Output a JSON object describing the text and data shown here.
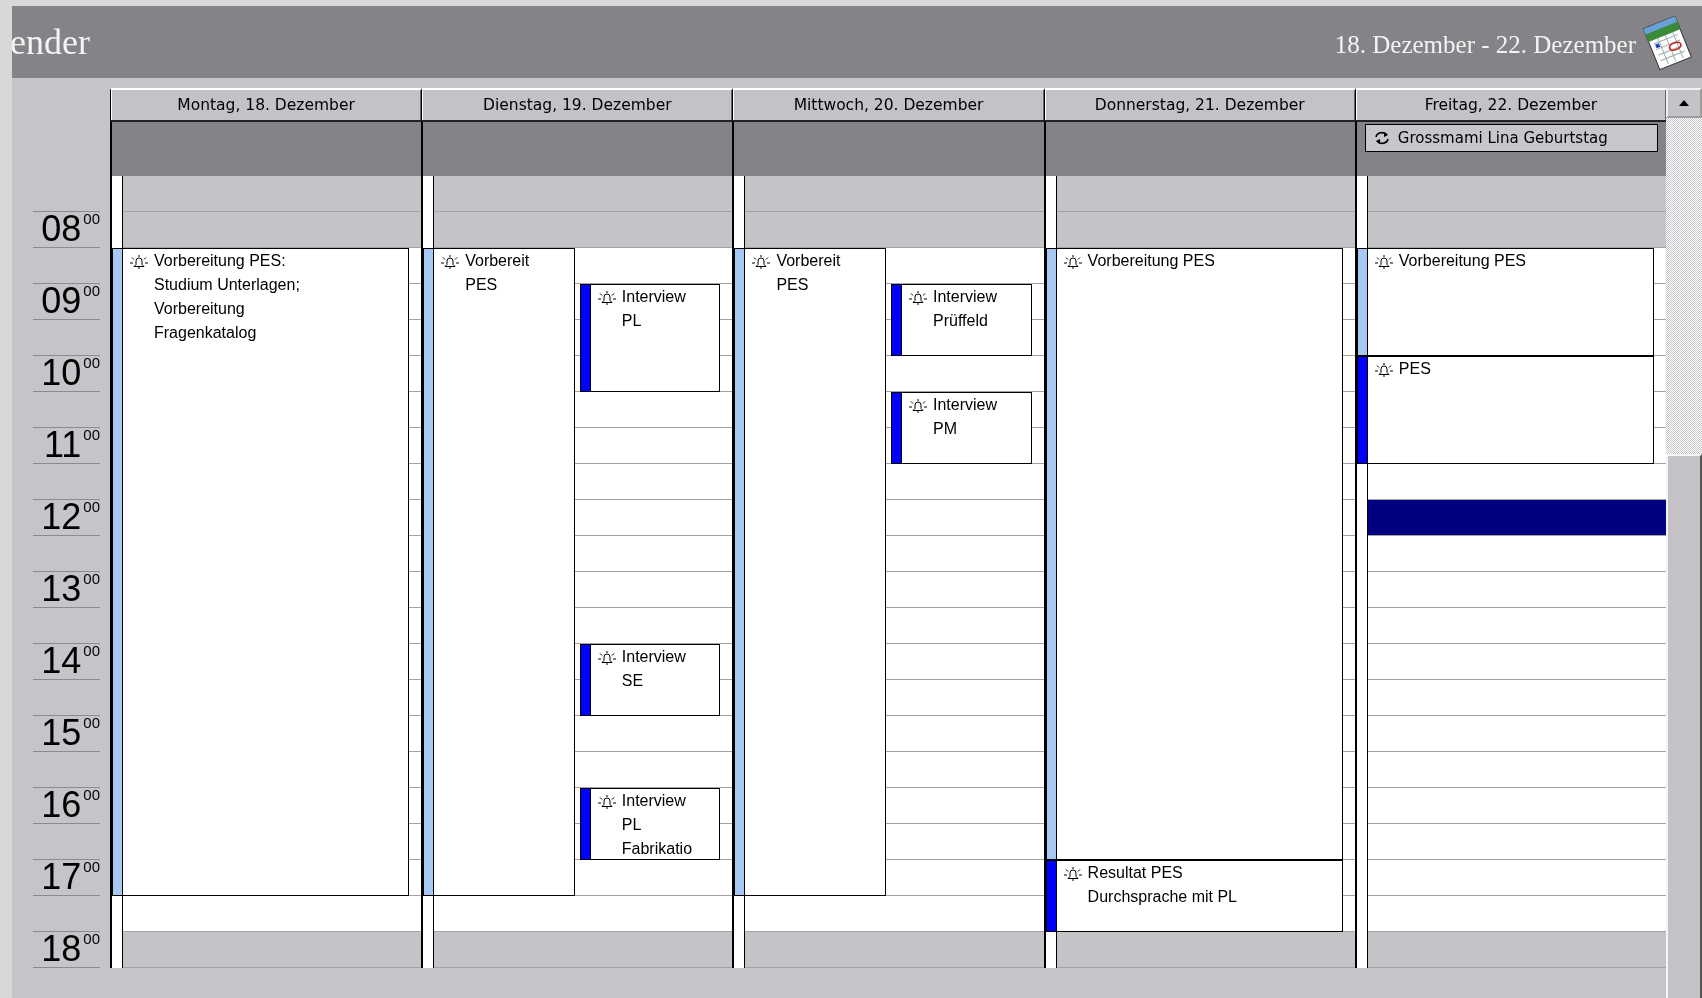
{
  "title_bar": {
    "title": "ender",
    "date_range": "18. Dezember - 22. Dezember"
  },
  "time_labels": [
    {
      "hour": "08",
      "minutes": "00"
    },
    {
      "hour": "09",
      "minutes": "00"
    },
    {
      "hour": "10",
      "minutes": "00"
    },
    {
      "hour": "11",
      "minutes": "00"
    },
    {
      "hour": "12",
      "minutes": "00"
    },
    {
      "hour": "13",
      "minutes": "00"
    },
    {
      "hour": "14",
      "minutes": "00"
    },
    {
      "hour": "15",
      "minutes": "00"
    },
    {
      "hour": "16",
      "minutes": "00"
    },
    {
      "hour": "17",
      "minutes": "00"
    },
    {
      "hour": "18",
      "minutes": "00"
    }
  ],
  "days": [
    {
      "header": "Montag, 18. Dezember",
      "selected": false,
      "events": [
        {
          "lines": [
            "Vorbereitung PES:",
            "Studium Unterlagen;",
            "Vorbereitung",
            "Fragenkatalog"
          ],
          "color": "#a6c8f2",
          "reminder": true
        }
      ]
    },
    {
      "header": "Dienstag, 19. Dezember",
      "selected": false,
      "events": [
        {
          "lines": [
            "Vorbereit",
            "PES"
          ],
          "color": "#a6c8f2",
          "reminder": true
        },
        {
          "lines": [
            "Interview",
            "PL"
          ],
          "color": "#0000ff",
          "reminder": true
        },
        {
          "lines": [
            "Interview",
            "SE"
          ],
          "color": "#0000ff",
          "reminder": true
        },
        {
          "lines": [
            "Interview",
            "PL",
            "Fabrikatio"
          ],
          "color": "#0000ff",
          "reminder": true
        }
      ]
    },
    {
      "header": "Mittwoch, 20. Dezember",
      "selected": false,
      "events": [
        {
          "lines": [
            "Vorbereit",
            "PES"
          ],
          "color": "#a6c8f2",
          "reminder": true
        },
        {
          "lines": [
            "Interview",
            "Prüffeld"
          ],
          "color": "#0000ff",
          "reminder": true
        },
        {
          "lines": [
            "Interview",
            "PM"
          ],
          "color": "#0000ff",
          "reminder": true
        }
      ]
    },
    {
      "header": "Donnerstag, 21. Dezember",
      "selected": false,
      "events": [
        {
          "lines": [
            "Vorbereitung PES"
          ],
          "color": "#a6c8f2",
          "reminder": true
        },
        {
          "lines": [
            "Resultat PES",
            "Durchsprache mit PL"
          ],
          "color": "#0000ff",
          "reminder": true
        }
      ]
    },
    {
      "header": "Freitag, 22. Dezember",
      "selected": true,
      "all_day": [
        {
          "title": "Grossmami Lina Geburtstag",
          "recurring": true
        }
      ],
      "events": [
        {
          "lines": [
            "Vorbereitung PES"
          ],
          "color": "#a6c8f2",
          "reminder": true
        },
        {
          "lines": [
            "PES"
          ],
          "color": "#0000ff",
          "reminder": true
        }
      ]
    }
  ]
}
